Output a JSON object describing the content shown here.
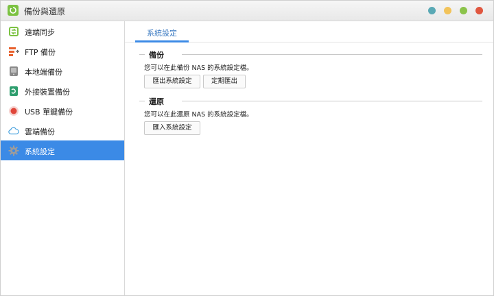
{
  "window": {
    "title": "備份與還原",
    "controls": [
      {
        "name": "help",
        "color": "#5aa9b5"
      },
      {
        "name": "minimize",
        "color": "#f2c35a"
      },
      {
        "name": "maximize",
        "color": "#8bc34a"
      },
      {
        "name": "close",
        "color": "#e0563f"
      }
    ]
  },
  "sidebar": {
    "items": [
      {
        "label": "遠端同步",
        "icon": "remote-sync-icon",
        "active": false
      },
      {
        "label": "FTP 備份",
        "icon": "ftp-backup-icon",
        "active": false
      },
      {
        "label": "本地端備份",
        "icon": "local-backup-icon",
        "active": false
      },
      {
        "label": "外接裝置備份",
        "icon": "external-device-icon",
        "active": false
      },
      {
        "label": "USB 單鍵備份",
        "icon": "usb-one-touch-icon",
        "active": false
      },
      {
        "label": "雲端備份",
        "icon": "cloud-backup-icon",
        "active": false
      },
      {
        "label": "系統設定",
        "icon": "gear-icon",
        "active": true
      }
    ]
  },
  "content": {
    "tabs": [
      {
        "label": "系統設定",
        "active": true
      }
    ],
    "backup": {
      "title": "備份",
      "description": "您可以在此備份 NAS 的系統設定檔。",
      "export_button": "匯出系統設定",
      "scheduled_export_button": "定期匯出"
    },
    "restore": {
      "title": "還原",
      "description": "您可以在此還原 NAS 的系統設定檔。",
      "import_button": "匯入系統設定"
    }
  },
  "colors": {
    "accent": "#3b8ae6",
    "tab_text": "#3a79c1"
  }
}
